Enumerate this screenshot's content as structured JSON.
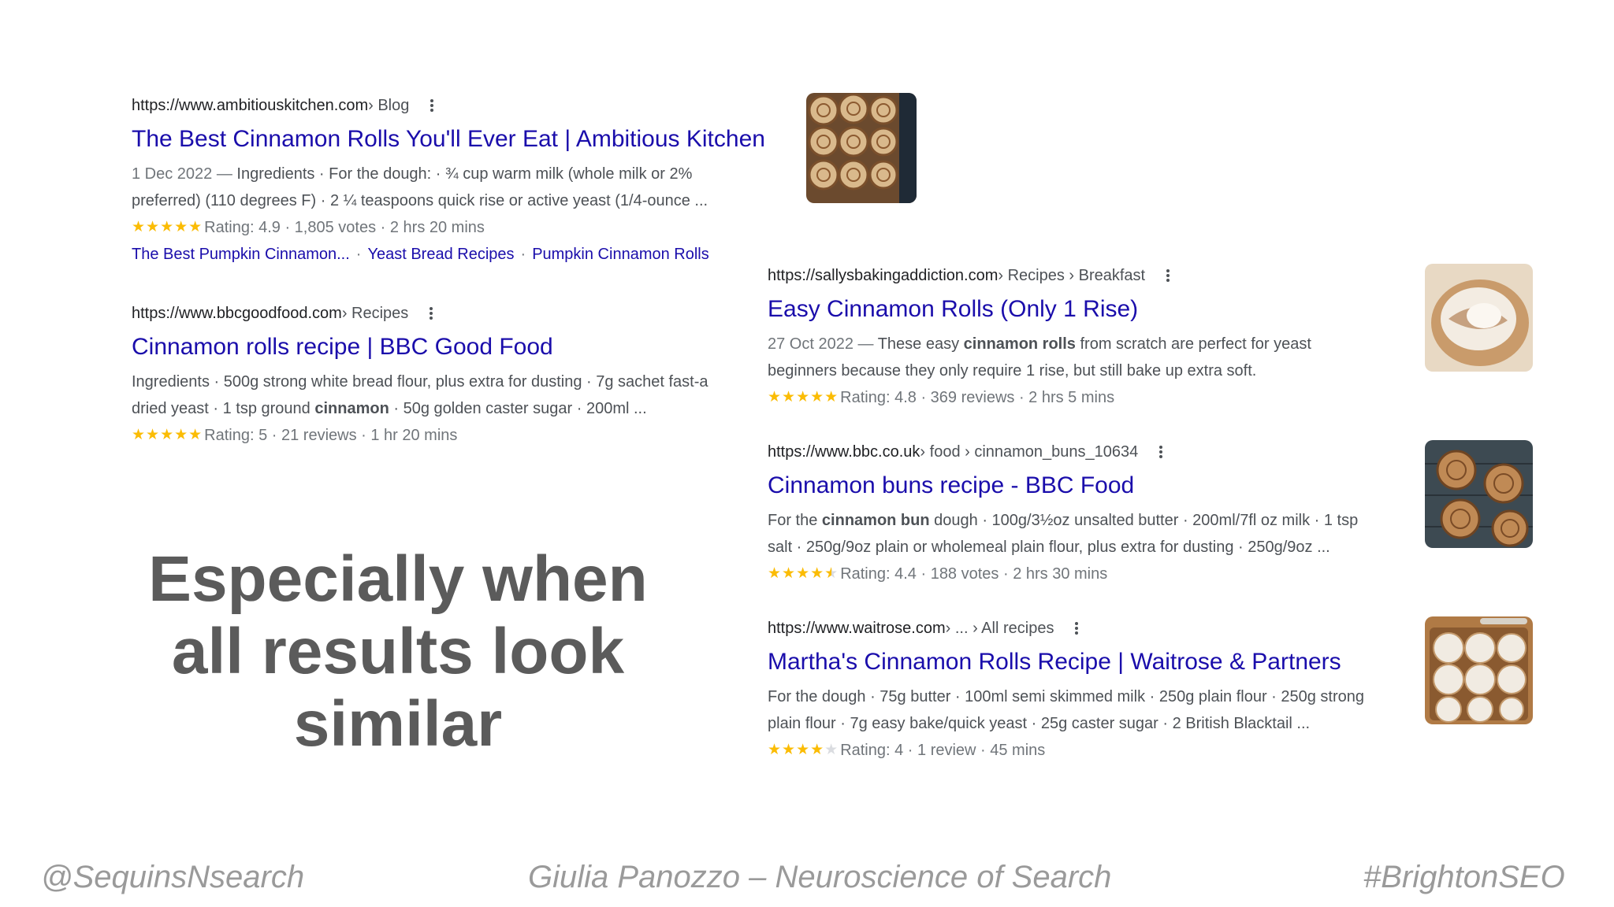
{
  "results": [
    {
      "url": "https://www.ambitiouskitchen.com",
      "crumbs": " › Blog",
      "title": "The Best Cinnamon Rolls You'll Ever Eat | Ambitious Kitchen",
      "date": "1 Dec 2022 — ",
      "snippet_line1": "Ingredients · For the dough: · ¾ cup warm milk (whole milk or 2%",
      "snippet_line2": "preferred) (110 degrees F) · 2 ¼ teaspoons quick rise or active yeast (1/4-ounce ...",
      "stars": 5,
      "meta": "Rating: 4.9 · 1,805 votes · 2 hrs 20 mins",
      "sitelinks": [
        "The Best Pumpkin Cinnamon...",
        "Yeast Bread Recipes",
        "Pumpkin Cinnamon Rolls"
      ],
      "thumbnail": "cinnamon-rolls-pan-photo"
    },
    {
      "url": "https://www.bbcgoodfood.com",
      "crumbs": " › Recipes",
      "title": "Cinnamon rolls recipe | BBC Good Food",
      "snippet_line1": "Ingredients · 500g strong white bread flour, plus extra for dusting · 7g sachet fast-a",
      "snippet_line2_pre": "dried yeast · 1 tsp ground ",
      "snippet_line2_bold": "cinnamon",
      "snippet_line2_post": " · 50g golden caster sugar · 200ml ...",
      "stars": 5,
      "meta": "Rating: 5 · 21 reviews · 1 hr 20 mins"
    },
    {
      "url": "https://sallysbakingaddiction.com",
      "crumbs": " › Recipes › Breakfast",
      "title": "Easy Cinnamon Rolls (Only 1 Rise)",
      "date": "27 Oct 2022 — ",
      "snippet_line1_pre": "These easy ",
      "snippet_line1_bold": "cinnamon rolls",
      "snippet_line1_post": " from scratch are perfect for yeast",
      "snippet_line2": "beginners because they only require 1 rise, but still bake up extra soft.",
      "stars": 5,
      "meta": "Rating: 4.8 · 369 reviews · 2 hrs 5 mins",
      "thumbnail": "iced-cinnamon-roll-closeup-photo"
    },
    {
      "url": "https://www.bbc.co.uk",
      "crumbs": " › food › cinnamon_buns_10634",
      "title": "Cinnamon buns recipe - BBC Food",
      "snippet_line1_pre": "For the ",
      "snippet_line1_bold": "cinnamon bun",
      "snippet_line1_post": " dough · 100g/3½oz unsalted butter · 200ml/7fl oz milk · 1 tsp",
      "snippet_line2": "salt · 250g/9oz plain or wholemeal plain flour, plus extra for dusting · 250g/9oz ...",
      "stars": 4.5,
      "meta": "Rating: 4.4 · 188 votes · 2 hrs 30 mins",
      "thumbnail": "cinnamon-buns-on-rack-photo"
    },
    {
      "url": "https://www.waitrose.com",
      "crumbs": " › ... › All recipes",
      "title": "Martha's Cinnamon Rolls Recipe | Waitrose & Partners",
      "snippet_line1": "For the dough · 75g butter · 100ml semi skimmed milk · 250g plain flour · 250g strong",
      "snippet_line2": "plain flour · 7g easy bake/quick yeast · 25g caster sugar · 2 British Blacktail ...",
      "stars": 4,
      "meta": "Rating: 4 · 1 review · 45 mins",
      "thumbnail": "frosted-rolls-in-tray-photo"
    }
  ],
  "headline": [
    "Especially when",
    "all results look",
    "similar"
  ],
  "footer": {
    "left": "@SequinsNsearch",
    "center": "Giulia Panozzo – Neuroscience of Search",
    "right": "#BrightonSEO"
  },
  "colors": {
    "link": "#1a0dab",
    "star": "#fbbc04",
    "snippet": "#4d5156",
    "headline": "#5b5b5b",
    "footer": "#9a9a9a"
  }
}
